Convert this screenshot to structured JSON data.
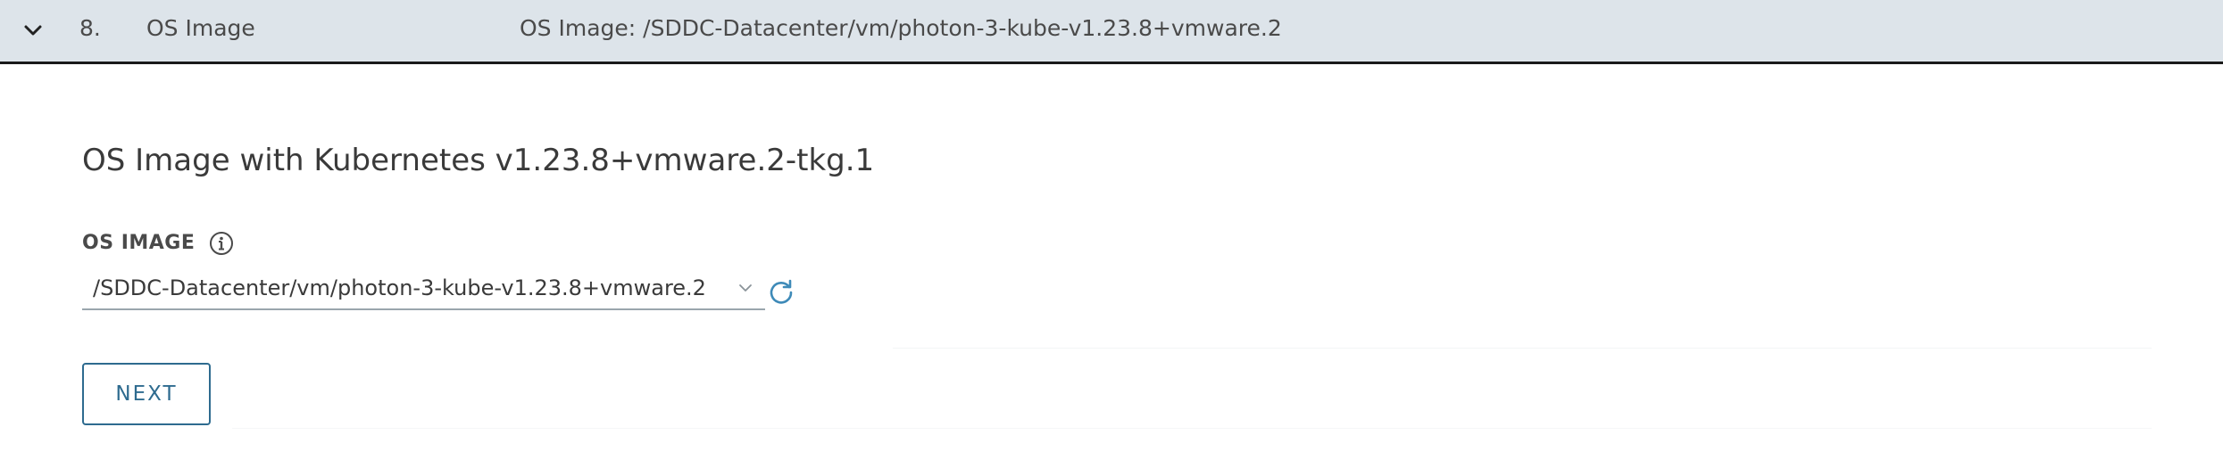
{
  "step": {
    "number": "8.",
    "title": "OS Image",
    "summary": "OS Image: /SDDC-Datacenter/vm/photon-3-kube-v1.23.8+vmware.2",
    "expanded": true
  },
  "content": {
    "heading": "OS Image with Kubernetes v1.23.8+vmware.2-tkg.1",
    "os_image_label": "OS IMAGE",
    "os_image_value": "/SDDC-Datacenter/vm/photon-3-kube-v1.23.8+vmware.2",
    "next_label": "NEXT"
  },
  "icons": {
    "collapse": "chevron-down-icon",
    "info": "info-icon",
    "caret": "chevron-down-icon",
    "refresh": "refresh-icon"
  },
  "colors": {
    "header_bg": "#dde4ea",
    "accent": "#2e6b8f",
    "refresh_icon": "#3e8ab8"
  }
}
